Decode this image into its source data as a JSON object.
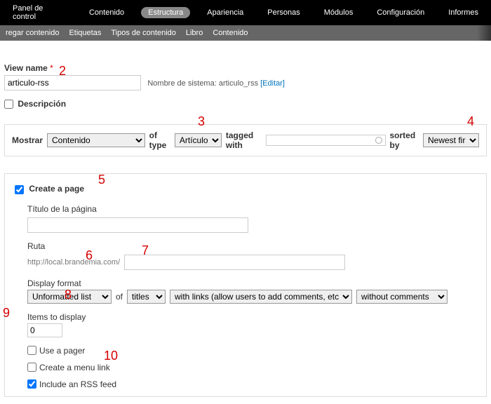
{
  "topnav": {
    "items": [
      {
        "label": "Panel de control"
      },
      {
        "label": "Contenido"
      },
      {
        "label": "Estructura",
        "active": true
      },
      {
        "label": "Apariencia"
      },
      {
        "label": "Personas"
      },
      {
        "label": "Módulos"
      },
      {
        "label": "Configuración"
      },
      {
        "label": "Informes"
      }
    ]
  },
  "subnav": {
    "items": [
      {
        "label": "regar contenido"
      },
      {
        "label": "Etiquetas"
      },
      {
        "label": "Tipos de contenido"
      },
      {
        "label": "Libro"
      },
      {
        "label": "Contenido"
      }
    ]
  },
  "view_name": {
    "label": "View name",
    "value": "articulo-rss",
    "helper_prefix": "Nombre de sistema: articulo_rss",
    "edit_link": "[Editar]"
  },
  "desc": {
    "label": "Descripción"
  },
  "filter": {
    "mostrar": "Mostrar",
    "show_val": "Contenido",
    "oftype": "of type",
    "type_val": "Artículo",
    "tagged": "tagged with",
    "sorted": "sorted by",
    "sort_val": "Newest first"
  },
  "page": {
    "create_label": "Create a page",
    "title_label": "Título de la página",
    "ruta_label": "Ruta",
    "ruta_prefix": "http://local.brandemia.com/",
    "display_label": "Display format",
    "disp_val": "Unformatted list",
    "of": "of",
    "of_val": "titles",
    "links_val": "with links (allow users to add comments, etc.)",
    "comments_val": "without comments",
    "items_label": "Items to display",
    "items_val": "0",
    "pager_label": "Use a pager",
    "menu_label": "Create a menu link",
    "rss_label": "Include an RSS feed"
  },
  "annot": {
    "a2": "2",
    "a3": "3",
    "a4": "4",
    "a5": "5",
    "a6": "6",
    "a7": "7",
    "a8": "8",
    "a9": "9",
    "a10": "10"
  }
}
